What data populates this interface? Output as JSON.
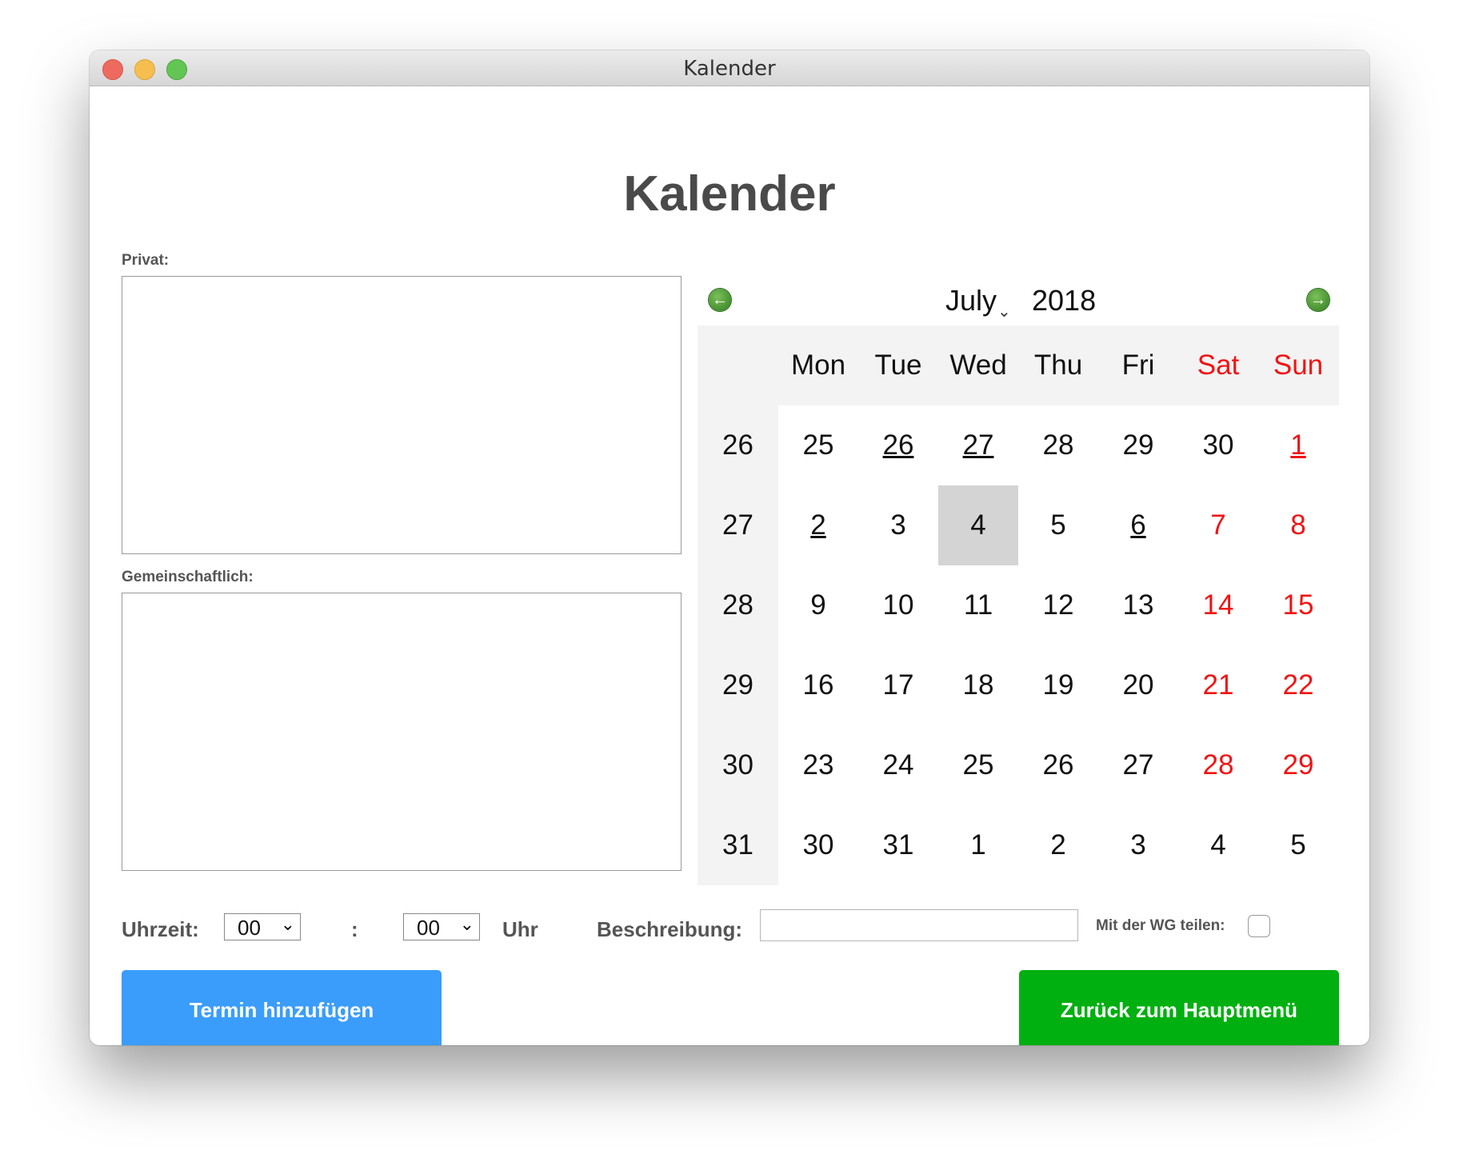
{
  "window": {
    "title": "Kalender"
  },
  "page_title": "Kalender",
  "private_label": "Privat:",
  "shared_label": "Gemeinschaftlich:",
  "calendar": {
    "month": "July",
    "year": "2018",
    "weekday_headers": [
      "Mon",
      "Tue",
      "Wed",
      "Thu",
      "Fri",
      "Sat",
      "Sun"
    ],
    "weeks": [
      {
        "week": "26",
        "days": [
          "25",
          "26",
          "27",
          "28",
          "29",
          "30",
          "1"
        ]
      },
      {
        "week": "27",
        "days": [
          "2",
          "3",
          "4",
          "5",
          "6",
          "7",
          "8"
        ]
      },
      {
        "week": "28",
        "days": [
          "9",
          "10",
          "11",
          "12",
          "13",
          "14",
          "15"
        ]
      },
      {
        "week": "29",
        "days": [
          "16",
          "17",
          "18",
          "19",
          "20",
          "21",
          "22"
        ]
      },
      {
        "week": "30",
        "days": [
          "23",
          "24",
          "25",
          "26",
          "27",
          "28",
          "29"
        ]
      },
      {
        "week": "31",
        "days": [
          "30",
          "31",
          "1",
          "2",
          "3",
          "4",
          "5"
        ]
      }
    ],
    "weekend_color": "#f01414",
    "selected_day": "4"
  },
  "form": {
    "time_label": "Uhrzeit:",
    "hour_value": "00",
    "separator": ":",
    "minute_value": "00",
    "unit_label": "Uhr",
    "description_label": "Beschreibung:",
    "description_value": "",
    "share_label": "Mit der WG teilen:"
  },
  "buttons": {
    "add_label": "Termin hinzufügen",
    "add_color": "#3a9dfb",
    "back_label": "Zurück zum Hauptmenü",
    "back_color": "#00b010"
  },
  "icons": {
    "prev": "arrow-left-circle-icon",
    "next": "arrow-right-circle-icon",
    "chevron": "chevron-down-icon"
  }
}
